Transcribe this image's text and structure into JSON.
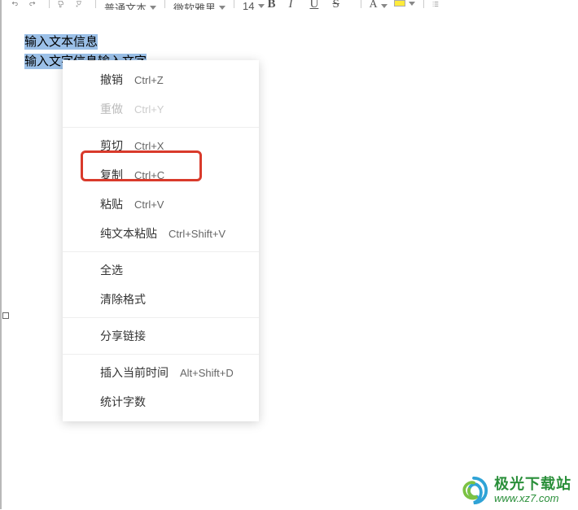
{
  "toolbar": {
    "style_dropdown": "普通文本",
    "font_dropdown": "微软雅黑",
    "size_dropdown": "14",
    "bold": "B",
    "italic": "I",
    "underline": "U",
    "strike": "S",
    "font_color_glyph": "A"
  },
  "editor": {
    "line1": "输入文本信息",
    "line2": "输入文字信息输入文字"
  },
  "context_menu": {
    "undo": {
      "label": "撤销",
      "shortcut": "Ctrl+Z"
    },
    "redo": {
      "label": "重做",
      "shortcut": "Ctrl+Y"
    },
    "cut": {
      "label": "剪切",
      "shortcut": "Ctrl+X"
    },
    "copy": {
      "label": "复制",
      "shortcut": "Ctrl+C"
    },
    "paste": {
      "label": "粘贴",
      "shortcut": "Ctrl+V"
    },
    "paste_plain": {
      "label": "纯文本粘贴",
      "shortcut": "Ctrl+Shift+V"
    },
    "select_all": {
      "label": "全选"
    },
    "clear_format": {
      "label": "清除格式"
    },
    "share_link": {
      "label": "分享链接"
    },
    "insert_time": {
      "label": "插入当前时间",
      "shortcut": "Alt+Shift+D"
    },
    "word_count": {
      "label": "统计字数"
    }
  },
  "watermark": {
    "title": "极光下载站",
    "url": "www.xz7.com"
  }
}
